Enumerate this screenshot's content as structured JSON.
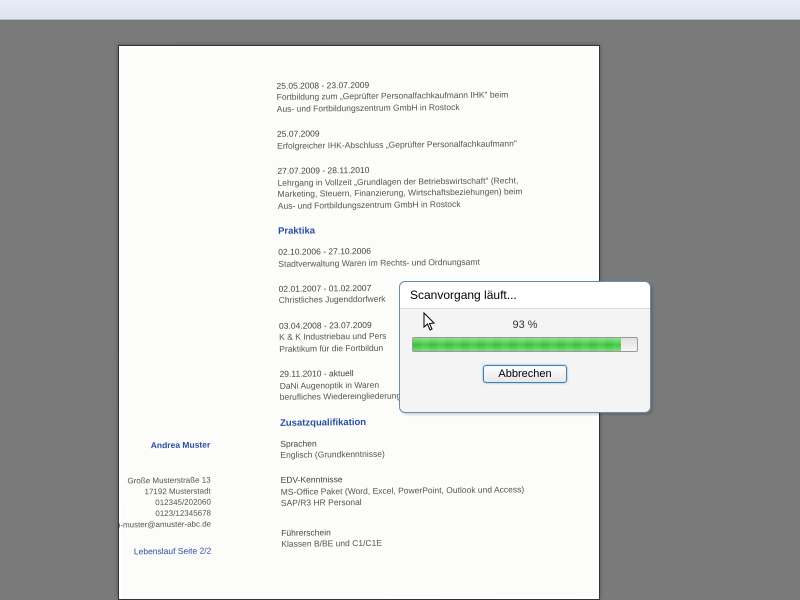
{
  "dialog": {
    "title": "Scanvorgang läuft...",
    "percent_label": "93 %",
    "percent_value": 93,
    "cancel_label": "Abbrechen"
  },
  "document": {
    "entries": [
      {
        "date": "25.05.2008 - 23.07.2009",
        "lines": [
          "Fortbildung zum „Geprüfter Personalfachkaufmann IHK\" beim",
          "Aus- und Fortbildungszentrum GmbH in Rostock"
        ]
      },
      {
        "date": "25.07.2009",
        "lines": [
          "Erfolgreicher IHK-Abschluss „Geprüfter Personalfachkaufmann\""
        ]
      },
      {
        "date": "27.07.2009 - 28.11.2010",
        "lines": [
          "Lehrgang in Vollzeit „Grundlagen der Betriebswirtschaft\" (Recht,",
          "Marketing, Steuern, Finanzierung, Wirtschaftsbeziehungen) beim",
          "Aus- und Fortbildungszentrum GmbH in Rostock"
        ]
      }
    ],
    "sections": [
      {
        "title": "Praktika",
        "entries": [
          {
            "date": "02.10.2006 - 27.10.2006",
            "lines": [
              "Stadtverwaltung Waren im Rechts- und Ordnungsamt"
            ]
          },
          {
            "date": "02.01.2007 - 01.02.2007",
            "lines": [
              "Christliches Jugenddorfwerk"
            ]
          },
          {
            "date": "03.04.2008 - 23.07.2009",
            "lines": [
              "K & K Industriebau und Pers",
              "Praktikum für die Fortbildun"
            ]
          },
          {
            "date": "29.11.2010 - aktuell",
            "lines": [
              "DaNi Augenoptik in Waren",
              "berufliches Wiedereingliederung"
            ]
          }
        ]
      },
      {
        "title": "Zusatzqualifikation",
        "left_label": "Andrea Muster",
        "entries": [
          {
            "date": "Sprachen",
            "lines": [
              "Englisch (Grundkenntnisse)"
            ]
          }
        ],
        "address_lines": [
          "Große Musterstraße 13",
          "17192 Musterstadt",
          "012345/202060",
          "0123/12345678",
          "an-muster@amuster-abc.de"
        ],
        "sub_entries": [
          {
            "date": "EDV-Kenntnisse",
            "lines": [
              "MS-Office Paket (Word, Excel, PowerPoint, Outlook und Access)",
              "SAP/R3 HR Personal"
            ]
          },
          {
            "date": "Führerschein",
            "lines": [
              "Klassen B/BE und C1/C1E"
            ]
          }
        ],
        "footer_left": "Lebenslauf Seite 2/2"
      }
    ]
  }
}
